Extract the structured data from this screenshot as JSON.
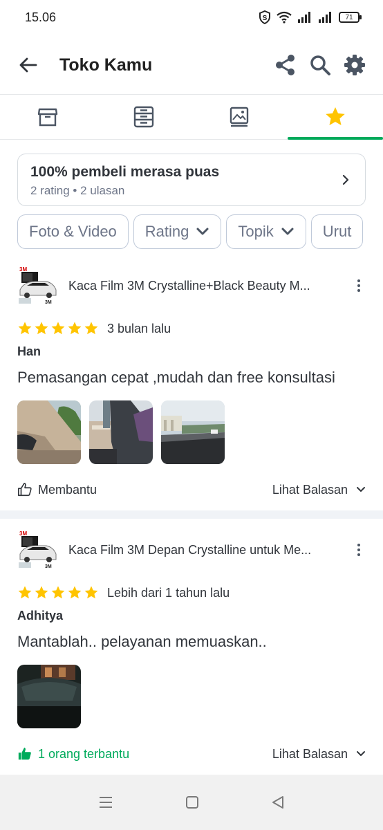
{
  "status": {
    "time": "15.06",
    "battery": "71"
  },
  "header": {
    "title": "Toko Kamu",
    "icons": [
      "back-arrow-icon",
      "share-icon",
      "search-icon",
      "gear-icon"
    ]
  },
  "tabs": [
    {
      "icon": "store-icon",
      "active": false
    },
    {
      "icon": "product-list-icon",
      "active": false
    },
    {
      "icon": "feed-image-icon",
      "active": false
    },
    {
      "icon": "star-icon",
      "active": true
    }
  ],
  "summary": {
    "title": "100% pembeli merasa puas",
    "subtitle": "2 rating • 2 ulasan"
  },
  "filters": [
    {
      "label": "Foto & Video",
      "dropdown": false
    },
    {
      "label": "Rating",
      "dropdown": true
    },
    {
      "label": "Topik",
      "dropdown": true
    },
    {
      "label": "Urut",
      "dropdown": false
    }
  ],
  "reviews": [
    {
      "product": "Kaca Film 3M Crystalline+Black Beauty M...",
      "stars": 5,
      "time": "3 bulan lalu",
      "reviewer": "Han",
      "text": "Pemasangan cepat ,mudah dan free konsultasi",
      "photo_count": 3,
      "helpful": "Membantu",
      "helpful_active": false,
      "see_reply": "Lihat Balasan"
    },
    {
      "product": "Kaca Film 3M Depan Crystalline untuk Me...",
      "stars": 5,
      "time": "Lebih dari 1 tahun lalu",
      "reviewer": "Adhitya",
      "text": "Mantablah.. pelayanan memuaskan..",
      "photo_count": 1,
      "helpful": "1 orang terbantu",
      "helpful_active": true,
      "see_reply": "Lihat Balasan"
    }
  ],
  "colors": {
    "accent": "#00aa5b",
    "star": "#ffc400",
    "text": "#31353b",
    "muted": "#6d7588"
  }
}
